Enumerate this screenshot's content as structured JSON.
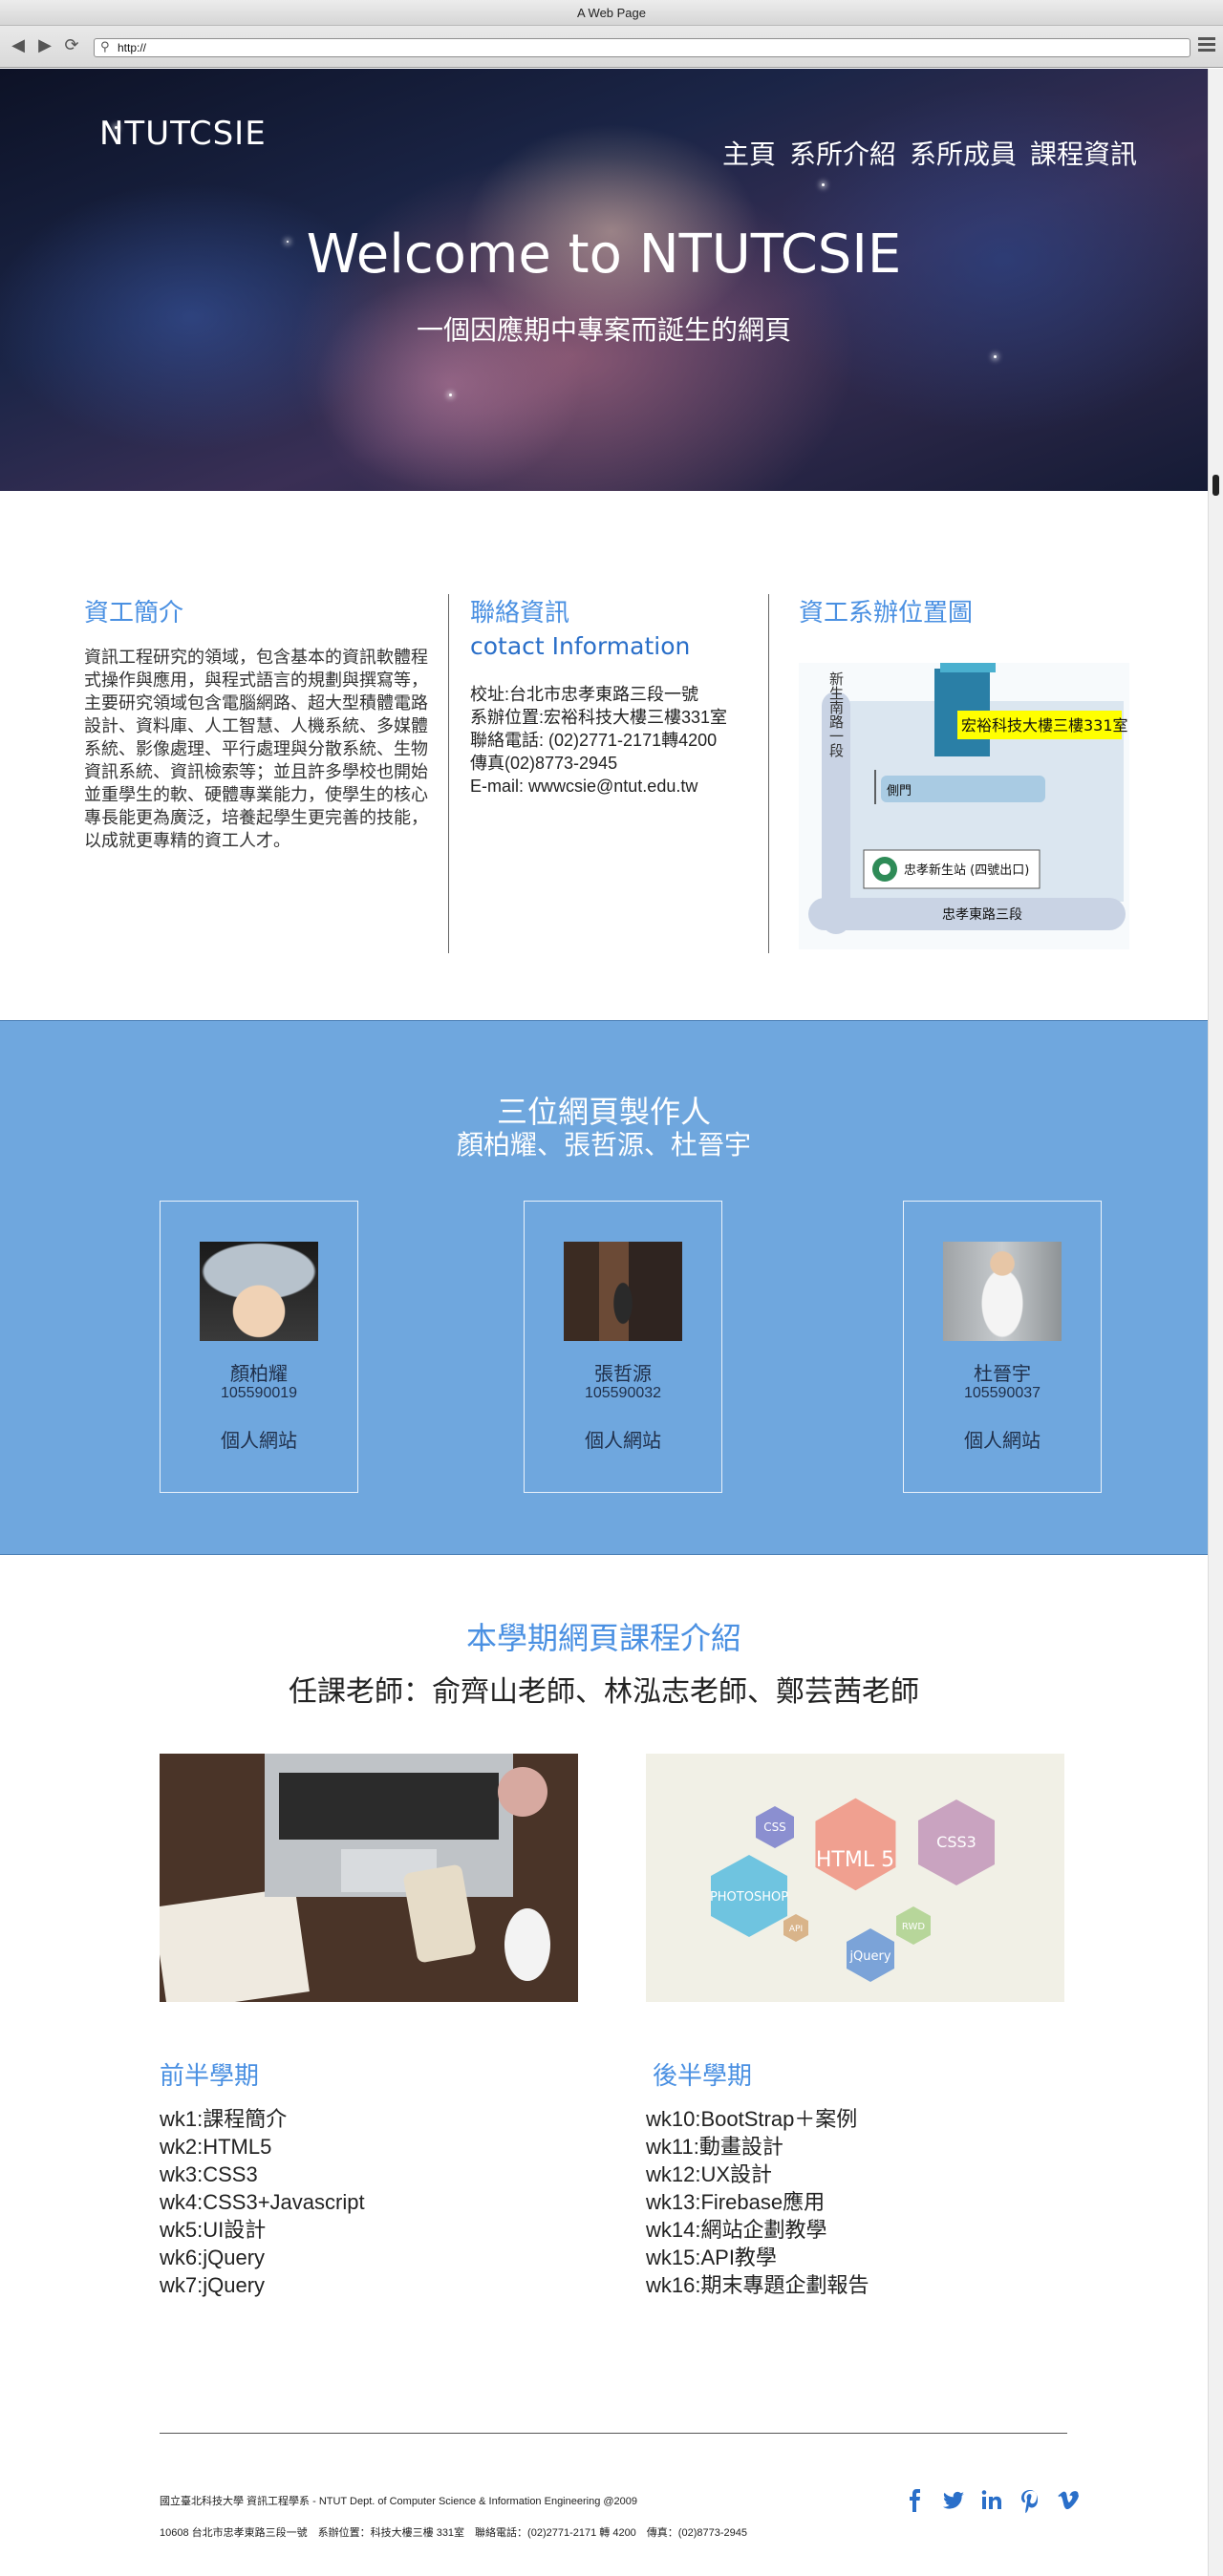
{
  "browser": {
    "window_title": "A Web Page",
    "url": "http://"
  },
  "hero": {
    "brand": "NTUTCSIE",
    "nav": [
      "主頁",
      "系所介紹",
      "系所成員",
      "課程資訊"
    ],
    "title": "Welcome to NTUTCSIE",
    "subtitle": "一個因應期中專案而誕生的網頁"
  },
  "about": {
    "heading": "資工簡介",
    "text": "資訊工程研究的領域，包含基本的資訊軟體程式操作與應用，與程式語言的規劃與撰寫等，主要研究領域包含電腦網路、超大型積體電路設計、資料庫、人工智慧、人機系統、多媒體系統、影像處理、平行處理與分散系統、生物資訊系統、資訊檢索等；並且許多學校也開始並重學生的軟、硬體專業能力，使學生的核心專長能更為廣泛，培養起學生更完善的技能，以成就更專精的資工人才。"
  },
  "contact": {
    "heading": "聯絡資訊",
    "heading_en": "cotact Information",
    "lines": [
      "校址:台北市忠孝東路三段一號",
      "系辦位置:宏裕科技大樓三樓331室",
      "聯絡電話: (02)2771-2171轉4200",
      "傳真(02)8773-2945",
      "E-mail: wwwcsie@ntut.edu.tw"
    ]
  },
  "map": {
    "heading": "資工系辦位置圖",
    "building_label": "宏裕科技大樓三樓331室",
    "road_vertical": "新生南路一段",
    "side_gate": "側門",
    "station": "忠孝新生站 (四號出口)",
    "road_horizontal": "忠孝東路三段"
  },
  "team": {
    "title": "三位網頁製作人",
    "names_line": "顏柏耀、張哲源、杜晉宇",
    "members": [
      {
        "name": "顏柏耀",
        "id": "105590019",
        "link": "個人網站"
      },
      {
        "name": "張哲源",
        "id": "105590032",
        "link": "個人網站"
      },
      {
        "name": "杜晉宇",
        "id": "105590037",
        "link": "個人網站"
      }
    ]
  },
  "course": {
    "title": "本學期網頁課程介紹",
    "teachers": "任課老師：俞齊山老師、林泓志老師、鄭芸茜老師",
    "image2_labels": [
      "CSS",
      "HTML 5",
      "CSS3",
      "PHOTOSHOP",
      "API",
      "RWD",
      "jQuery"
    ],
    "first_half": {
      "heading": "前半學期",
      "weeks": [
        "wk1:課程簡介",
        "wk2:HTML5",
        "wk3:CSS3",
        "wk4:CSS3+Javascript",
        "wk5:UI設計",
        "wk6:jQuery",
        "wk7:jQuery"
      ]
    },
    "second_half": {
      "heading": "後半學期",
      "weeks": [
        "wk10:BootStrap＋案例",
        "wk11:動畫設計",
        "wk12:UX設計",
        "wk13:Firebase應用",
        "wk14:網站企劃教學",
        "wk15:API教學",
        "wk16:期末專題企劃報告"
      ]
    }
  },
  "footer": {
    "line1": "國立臺北科技大學 資訊工程學系 - NTUT Dept. of Computer Science & Information Engineering @2009",
    "line2": "10608 台北市忠孝東路三段一號　系辦位置：科技大樓三樓 331室　聯絡電話：(02)2771-2171 轉 4200　傳真：(02)8773-2945",
    "social": [
      "facebook-icon",
      "twitter-icon",
      "linkedin-icon",
      "pinterest-icon",
      "vimeo-icon"
    ]
  },
  "colors": {
    "accent": "#4a90e2",
    "team_bg": "#6fa7de",
    "social": "#2a6fc9"
  }
}
